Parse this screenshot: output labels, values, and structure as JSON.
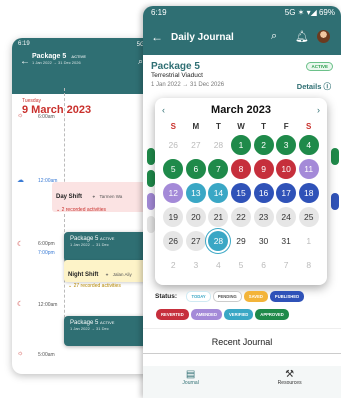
{
  "background_phone": {
    "status_time": "6:19",
    "status_icons": "5G ✶ ▾",
    "title": "Package 5",
    "badge": "ACTIVE",
    "subtitle": "1 Jan 2022 → 31 Dec 2026",
    "weekday": "Tuesday",
    "date": "9 March 2023",
    "times": [
      "6:00am",
      "12:00am",
      "6:00pm",
      "7:00pm",
      "12:00am",
      "5:00am"
    ],
    "day_shift": {
      "title": "Day Shift",
      "location": "Tarmen Wa",
      "count": "2 recorded activities"
    },
    "night_shift": {
      "title": "Night Shift",
      "location": "Jalan Aliy",
      "count": "27 recorded activities"
    },
    "float_title": "Package 5",
    "float_badge": "ACTIVE",
    "float_sub": "1 Jan 2022 → 31 Dec"
  },
  "main_phone": {
    "status_time": "6:19",
    "status_icons": "5G ✶ ▾◢ 69%",
    "app_title": "Daily Journal",
    "package_title": "Package 5",
    "package_subtitle": "Terrestrial Viaduct",
    "package_dates": "1 Jan 2022  →  31 Dec 2026",
    "active_badge": "ACTIVE",
    "details_label": "Details",
    "calendar": {
      "month_label": "March  2023",
      "weekdays": [
        "S",
        "M",
        "T",
        "W",
        "T",
        "F",
        "S"
      ],
      "rows": [
        [
          {
            "d": "26",
            "s": "muted"
          },
          {
            "d": "27",
            "s": "muted"
          },
          {
            "d": "28",
            "s": "muted"
          },
          {
            "d": "1",
            "s": "green"
          },
          {
            "d": "2",
            "s": "green"
          },
          {
            "d": "3",
            "s": "green"
          },
          {
            "d": "4",
            "s": "green"
          }
        ],
        [
          {
            "d": "5",
            "s": "green"
          },
          {
            "d": "6",
            "s": "green"
          },
          {
            "d": "7",
            "s": "green"
          },
          {
            "d": "8",
            "s": "red"
          },
          {
            "d": "9",
            "s": "red"
          },
          {
            "d": "10",
            "s": "red"
          },
          {
            "d": "11",
            "s": "purple"
          }
        ],
        [
          {
            "d": "12",
            "s": "purple"
          },
          {
            "d": "13",
            "s": "cyan"
          },
          {
            "d": "14",
            "s": "cyan"
          },
          {
            "d": "15",
            "s": "blue"
          },
          {
            "d": "16",
            "s": "blue"
          },
          {
            "d": "17",
            "s": "blue"
          },
          {
            "d": "18",
            "s": "blue"
          }
        ],
        [
          {
            "d": "19",
            "s": "gray"
          },
          {
            "d": "20",
            "s": "gray"
          },
          {
            "d": "21",
            "s": "gray"
          },
          {
            "d": "22",
            "s": "gray"
          },
          {
            "d": "23",
            "s": "gray"
          },
          {
            "d": "24",
            "s": "gray"
          },
          {
            "d": "25",
            "s": "gray"
          }
        ],
        [
          {
            "d": "26",
            "s": "gray"
          },
          {
            "d": "27",
            "s": "gray"
          },
          {
            "d": "28",
            "s": "today"
          },
          {
            "d": "29",
            "s": "plain"
          },
          {
            "d": "30",
            "s": "plain"
          },
          {
            "d": "31",
            "s": "plain"
          },
          {
            "d": "1",
            "s": "muted"
          }
        ],
        [
          {
            "d": "2",
            "s": "muted"
          },
          {
            "d": "3",
            "s": "muted"
          },
          {
            "d": "4",
            "s": "muted"
          },
          {
            "d": "5",
            "s": "muted"
          },
          {
            "d": "6",
            "s": "muted"
          },
          {
            "d": "7",
            "s": "muted"
          },
          {
            "d": "8",
            "s": "muted"
          }
        ]
      ]
    },
    "status_label": "Status:",
    "status_chips": [
      {
        "label": "TODAY",
        "bg": "#ffffff",
        "fg": "#3aa7c5",
        "border": "#cfeaf3"
      },
      {
        "label": "PENDING",
        "bg": "#ffffff",
        "fg": "#555555",
        "border": "#cccccc"
      },
      {
        "label": "SAVED",
        "bg": "#f3b43a",
        "fg": "#ffffff",
        "border": "#f3b43a"
      },
      {
        "label": "PUBLISHED",
        "bg": "#2f52b8",
        "fg": "#ffffff",
        "border": "#2f52b8"
      },
      {
        "label": "REVERTED",
        "bg": "#c62f3c",
        "fg": "#ffffff",
        "border": "#c62f3c"
      },
      {
        "label": "AMENDED",
        "bg": "#a48ad8",
        "fg": "#ffffff",
        "border": "#a48ad8"
      },
      {
        "label": "VERIFIED",
        "bg": "#3aa7c5",
        "fg": "#ffffff",
        "border": "#3aa7c5"
      },
      {
        "label": "APPROVED",
        "bg": "#1f8a4a",
        "fg": "#ffffff",
        "border": "#1f8a4a"
      }
    ],
    "recent_journal": "Recent Journal",
    "nav": [
      {
        "label": "Journal",
        "icon": "journal-icon"
      },
      {
        "label": "Resources",
        "icon": "resources-icon"
      }
    ]
  },
  "colors": {
    "teal": "#2f6f73",
    "green": "#1f8a4a",
    "red": "#c62f3c",
    "purple": "#a48ad8",
    "cyan": "#3aa7c5",
    "blue": "#2f52b8"
  }
}
